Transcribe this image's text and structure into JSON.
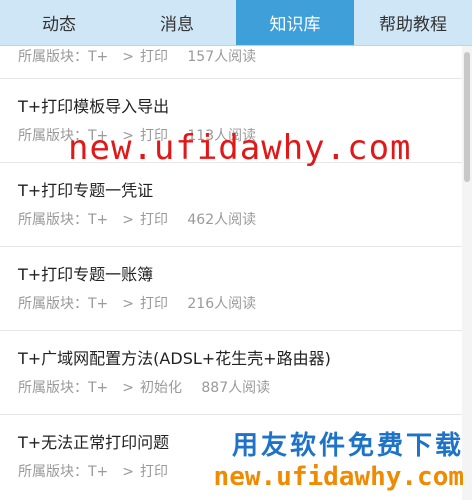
{
  "tabs": [
    {
      "label": "动态"
    },
    {
      "label": "消息"
    },
    {
      "label": "知识库"
    },
    {
      "label": "帮助教程"
    }
  ],
  "articles": [
    {
      "title": "",
      "board_prefix": "所属版块：T+",
      "category": "打印",
      "reads": "157人阅读"
    },
    {
      "title": "T+打印模板导入导出",
      "board_prefix": "所属版块：T+",
      "category": "打印",
      "reads": "113人阅读"
    },
    {
      "title": "T+打印专题一凭证",
      "board_prefix": "所属版块：T+",
      "category": "打印",
      "reads": "462人阅读"
    },
    {
      "title": "T+打印专题一账簿",
      "board_prefix": "所属版块：T+",
      "category": "打印",
      "reads": "216人阅读"
    },
    {
      "title": "T+广域网配置方法(ADSL+花生壳+路由器)",
      "board_prefix": "所属版块：T+",
      "category": "初始化",
      "reads": "887人阅读"
    },
    {
      "title": "T+无法正常打印问题",
      "board_prefix": "所属版块：T+",
      "category": "打印",
      "reads": ""
    }
  ],
  "watermark": {
    "url_center": "new.ufidawhy.com",
    "slogan": "用友软件免费下载",
    "url_bottom": "new.ufidawhy.com"
  },
  "colors": {
    "tab_bar": "#cfe6f6",
    "tab_active": "#3f9fd8",
    "watermark_red": "#e21818",
    "watermark_blue": "#1e73c8",
    "watermark_orange": "#f08a00"
  }
}
